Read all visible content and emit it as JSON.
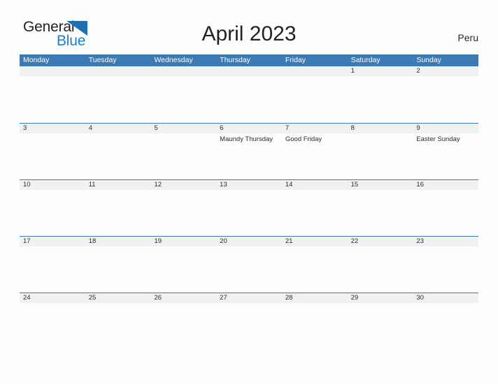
{
  "logo": {
    "part1": "General",
    "part2": "Blue",
    "triangle_color": "#1f6fb4",
    "blue_text_color": "#1f7fc4"
  },
  "header": {
    "title": "April 2023",
    "country": "Peru"
  },
  "theme": {
    "header_blue": "#3b7ab5",
    "date_band_gray": "#f1f1f1",
    "page_background": "#fdfdfd",
    "text_color": "#2b2b2b"
  },
  "calendar": {
    "weekdays": [
      "Monday",
      "Tuesday",
      "Wednesday",
      "Thursday",
      "Friday",
      "Saturday",
      "Sunday"
    ],
    "weeks": [
      {
        "days": [
          {
            "date": "",
            "event": ""
          },
          {
            "date": "",
            "event": ""
          },
          {
            "date": "",
            "event": ""
          },
          {
            "date": "",
            "event": ""
          },
          {
            "date": "",
            "event": ""
          },
          {
            "date": "1",
            "event": ""
          },
          {
            "date": "2",
            "event": ""
          }
        ]
      },
      {
        "days": [
          {
            "date": "3",
            "event": ""
          },
          {
            "date": "4",
            "event": ""
          },
          {
            "date": "5",
            "event": ""
          },
          {
            "date": "6",
            "event": "Maundy Thursday"
          },
          {
            "date": "7",
            "event": "Good Friday"
          },
          {
            "date": "8",
            "event": ""
          },
          {
            "date": "9",
            "event": "Easter Sunday"
          }
        ]
      },
      {
        "days": [
          {
            "date": "10",
            "event": ""
          },
          {
            "date": "11",
            "event": ""
          },
          {
            "date": "12",
            "event": ""
          },
          {
            "date": "13",
            "event": ""
          },
          {
            "date": "14",
            "event": ""
          },
          {
            "date": "15",
            "event": ""
          },
          {
            "date": "16",
            "event": ""
          }
        ]
      },
      {
        "days": [
          {
            "date": "17",
            "event": ""
          },
          {
            "date": "18",
            "event": ""
          },
          {
            "date": "19",
            "event": ""
          },
          {
            "date": "20",
            "event": ""
          },
          {
            "date": "21",
            "event": ""
          },
          {
            "date": "22",
            "event": ""
          },
          {
            "date": "23",
            "event": ""
          }
        ]
      },
      {
        "days": [
          {
            "date": "24",
            "event": ""
          },
          {
            "date": "25",
            "event": ""
          },
          {
            "date": "26",
            "event": ""
          },
          {
            "date": "27",
            "event": ""
          },
          {
            "date": "28",
            "event": ""
          },
          {
            "date": "29",
            "event": ""
          },
          {
            "date": "30",
            "event": ""
          }
        ]
      }
    ]
  }
}
